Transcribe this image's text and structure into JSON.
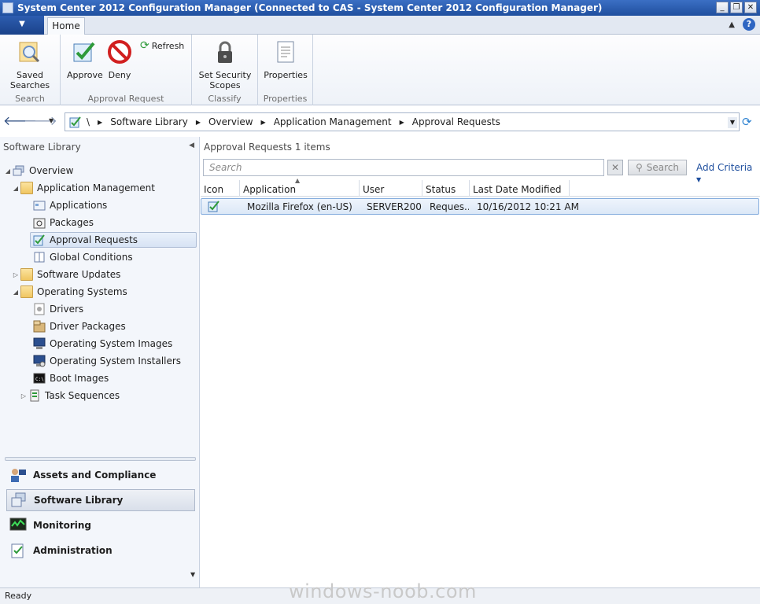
{
  "window": {
    "title": "System Center 2012 Configuration Manager (Connected to CAS - System Center 2012 Configuration Manager)",
    "controls": {
      "minimize": "_",
      "restore": "❐",
      "close": "✕"
    }
  },
  "ribbon": {
    "app_menu": "▼",
    "tabs": [
      {
        "label": "Home",
        "active": true
      }
    ],
    "groups": [
      {
        "label": "Search",
        "buttons": [
          {
            "label": "Saved Searches",
            "icon": "saved-searches-icon"
          }
        ]
      },
      {
        "label": "Approval Request",
        "buttons": [
          {
            "label": "Approve",
            "icon": "approve-icon"
          },
          {
            "label": "Deny",
            "icon": "deny-icon"
          },
          {
            "label": "Refresh",
            "icon": "refresh-icon"
          }
        ]
      },
      {
        "label": "Classify",
        "buttons": [
          {
            "label": "Set Security Scopes",
            "icon": "lock-icon"
          }
        ]
      },
      {
        "label": "Properties",
        "buttons": [
          {
            "label": "Properties",
            "icon": "properties-icon"
          }
        ]
      }
    ]
  },
  "address_bar": {
    "root": "\\",
    "breadcrumb": [
      "Software Library",
      "Overview",
      "Application Management",
      "Approval Requests"
    ]
  },
  "navigation": {
    "header": "Software Library",
    "tree": [
      {
        "label": "Overview",
        "level": 0,
        "expanded": true
      },
      {
        "label": "Application Management",
        "level": 1,
        "expanded": true
      },
      {
        "label": "Applications",
        "level": 2
      },
      {
        "label": "Packages",
        "level": 2
      },
      {
        "label": "Approval Requests",
        "level": 2,
        "selected": true
      },
      {
        "label": "Global Conditions",
        "level": 2
      },
      {
        "label": "Software Updates",
        "level": 1,
        "expanded": false
      },
      {
        "label": "Operating Systems",
        "level": 1,
        "expanded": true
      },
      {
        "label": "Drivers",
        "level": 2
      },
      {
        "label": "Driver Packages",
        "level": 2
      },
      {
        "label": "Operating System Images",
        "level": 2
      },
      {
        "label": "Operating System Installers",
        "level": 2
      },
      {
        "label": "Boot Images",
        "level": 2
      },
      {
        "label": "Task Sequences",
        "level": 2,
        "expanded": false
      }
    ],
    "workspaces": [
      {
        "label": "Assets and Compliance"
      },
      {
        "label": "Software Library",
        "active": true
      },
      {
        "label": "Monitoring"
      },
      {
        "label": "Administration"
      }
    ]
  },
  "main": {
    "title": "Approval Requests",
    "count": "1 items",
    "search_placeholder": "Search",
    "search_button": "Search",
    "add_criteria": "Add Criteria",
    "columns": [
      "Icon",
      "Application",
      "User",
      "Status",
      "Last Date Modified"
    ],
    "rows": [
      {
        "application": "Mozilla Firefox (en-US)",
        "user": "SERVER200...",
        "status": "Reques...",
        "modified": "10/16/2012 10:21 AM"
      }
    ]
  },
  "status_bar": {
    "text": "Ready"
  },
  "watermark": "windows-noob.com",
  "colors": {
    "title_bar": "#2a5cb0",
    "accent": "#1f4f9e",
    "selection": "#dce8f7",
    "pane": "#f3f6fb"
  }
}
